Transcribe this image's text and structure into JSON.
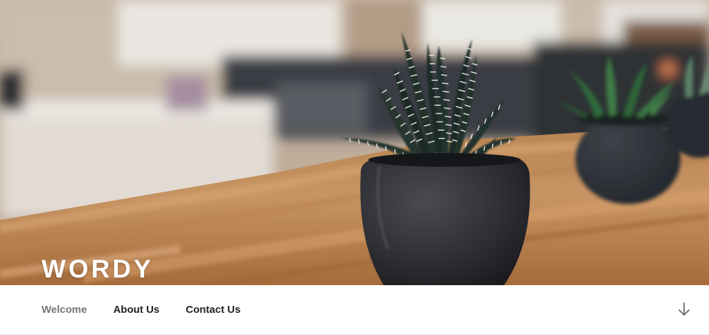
{
  "site": {
    "title": "WORDY"
  },
  "nav": {
    "items": [
      {
        "label": "Welcome",
        "current": true
      },
      {
        "label": "About Us",
        "current": false
      },
      {
        "label": "Contact Us",
        "current": false
      }
    ],
    "scroll_icon": "arrow-down-icon"
  },
  "colors": {
    "nav_text": "#222222",
    "nav_current": "#767676",
    "title": "#ffffff"
  }
}
